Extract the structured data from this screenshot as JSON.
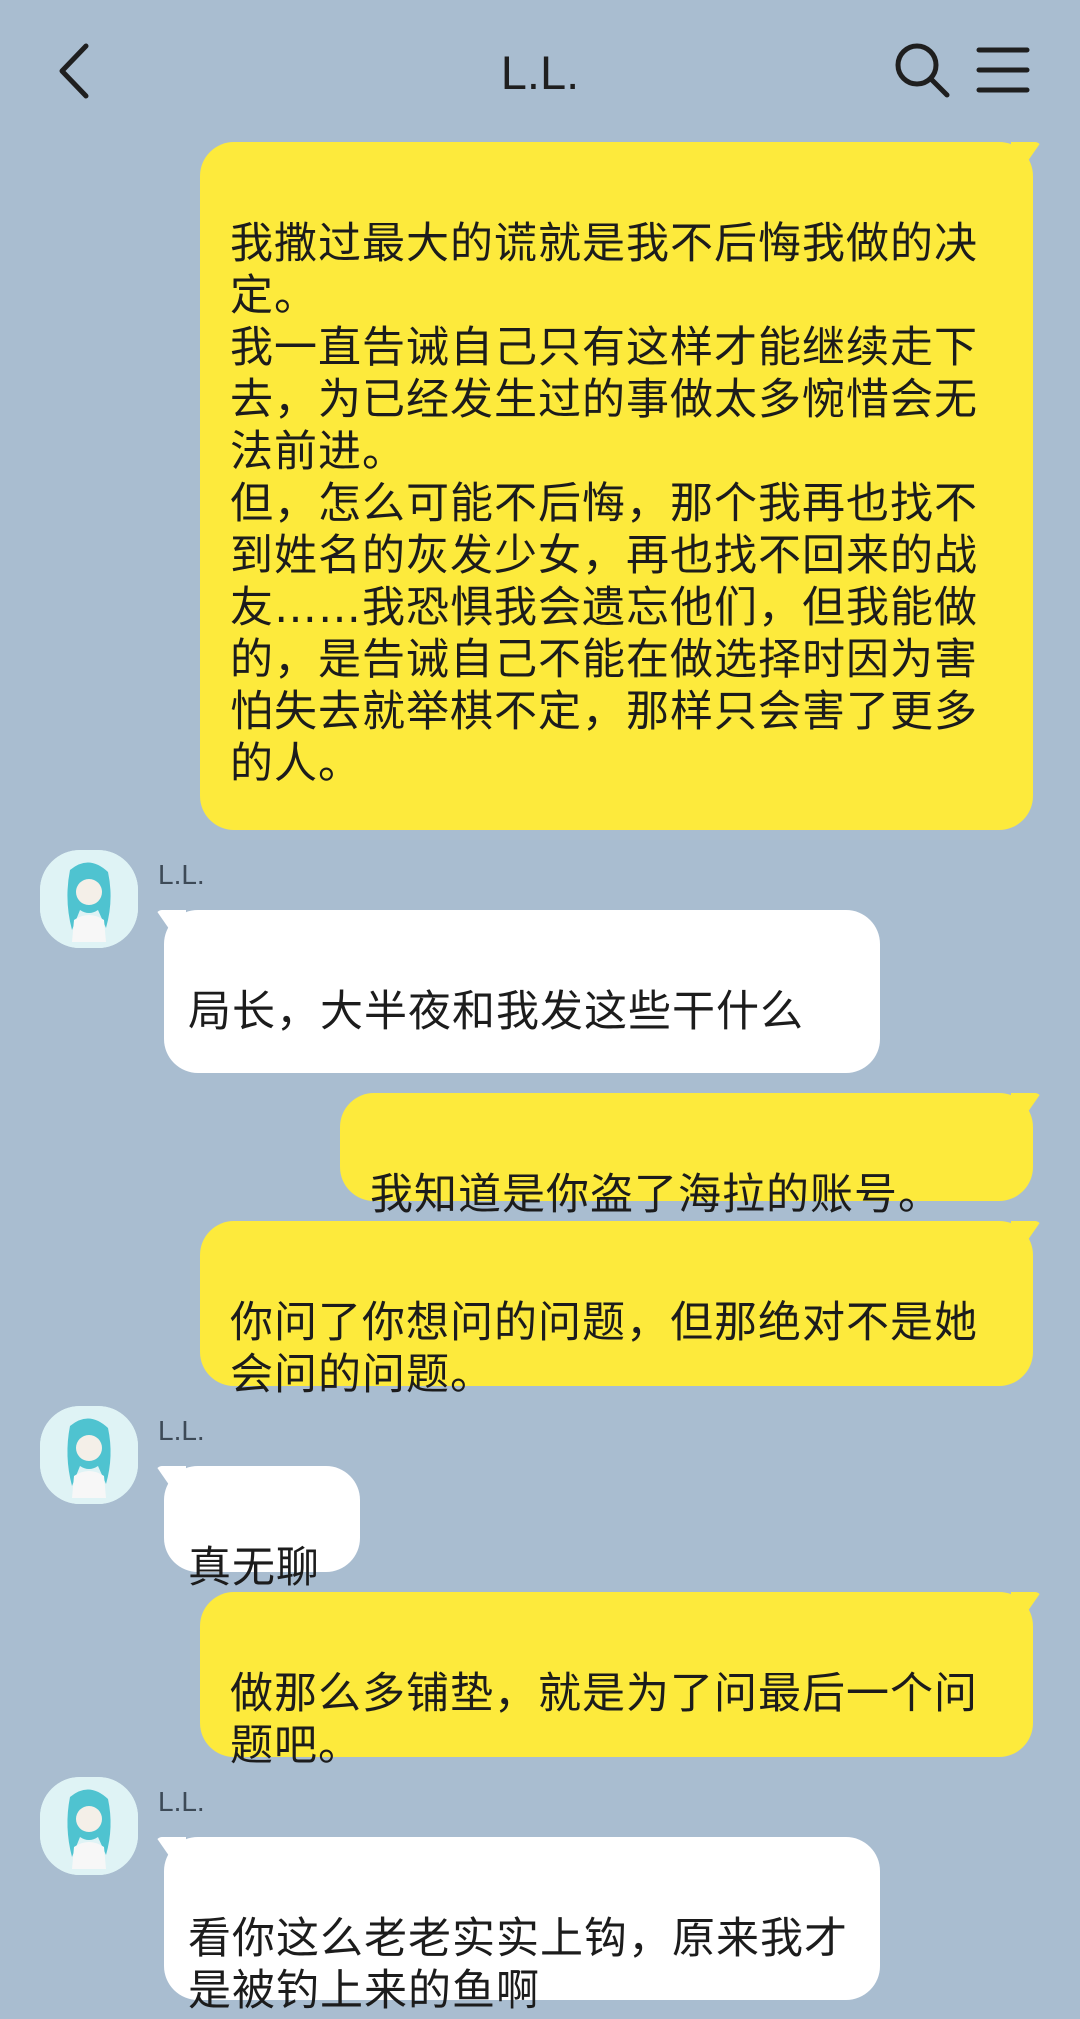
{
  "header": {
    "title": "L.L.",
    "back_icon": "chevron-left-icon",
    "search_icon": "search-icon",
    "menu_icon": "hamburger-menu-icon"
  },
  "colors": {
    "background": "#a9bdd0",
    "outgoing_bubble": "#fdea3c",
    "incoming_bubble": "#ffffff"
  },
  "messages": [
    {
      "direction": "out",
      "text": "我撒过最大的谎就是我不后悔我做的决定。\n我一直告诫自己只有这样才能继续走下去，为已经发生过的事做太多惋惜会无法前进。\n但，怎么可能不后悔，那个我再也找不到姓名的灰发少女，再也找不回来的战友……我恐惧我会遗忘他们，但我能做的，是告诫自己不能在做选择时因为害怕失去就举棋不定，那样只会害了更多的人。"
    },
    {
      "direction": "in",
      "sender": "L.L.",
      "text": "局长，大半夜和我发这些干什么"
    },
    {
      "direction": "out",
      "text": "我知道是你盗了海拉的账号。"
    },
    {
      "direction": "out",
      "text": "你问了你想问的问题，但那绝对不是她会问的问题。"
    },
    {
      "direction": "in",
      "sender": "L.L.",
      "text": "真无聊"
    },
    {
      "direction": "out",
      "text": "做那么多铺垫，就是为了问最后一个问题吧。"
    },
    {
      "direction": "in",
      "sender": "L.L.",
      "text": "看你这么老老实实上钩，原来我才是被钓上来的鱼啊"
    }
  ]
}
